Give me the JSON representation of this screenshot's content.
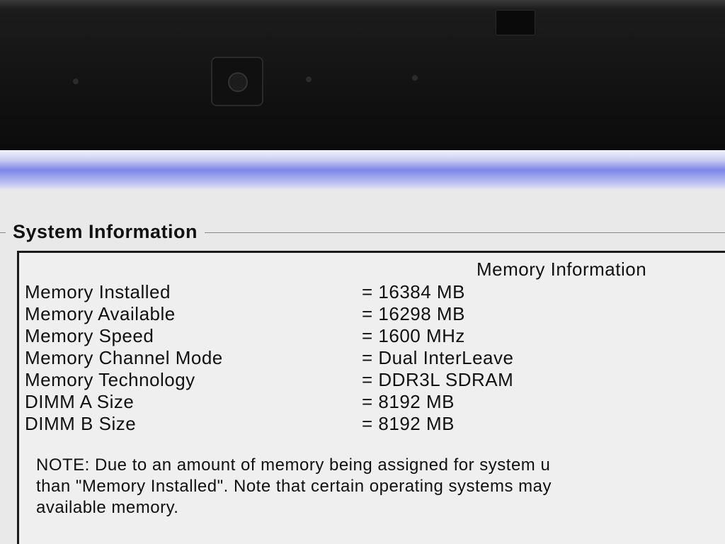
{
  "group_title": "System Information",
  "panel_header": "Memory Information",
  "memory_rows": [
    {
      "label": "Memory Installed",
      "value": "= 16384 MB"
    },
    {
      "label": "Memory Available",
      "value": "= 16298 MB"
    },
    {
      "label": "Memory Speed",
      "value": "= 1600 MHz"
    },
    {
      "label": "Memory Channel Mode",
      "value": "= Dual InterLeave"
    },
    {
      "label": "Memory Technology",
      "value": "= DDR3L SDRAM"
    },
    {
      "label": "DIMM A Size",
      "value": "= 8192 MB"
    },
    {
      "label": "DIMM B Size",
      "value": "= 8192 MB"
    }
  ],
  "note_lines": [
    "NOTE: Due to an amount of memory being assigned for system u",
    "than \"Memory Installed\". Note that certain operating systems may",
    "available memory."
  ],
  "colors": {
    "title_bar_accent": "#7d86e8",
    "screen_background": "#e9e9e9",
    "bezel": "#141414"
  }
}
